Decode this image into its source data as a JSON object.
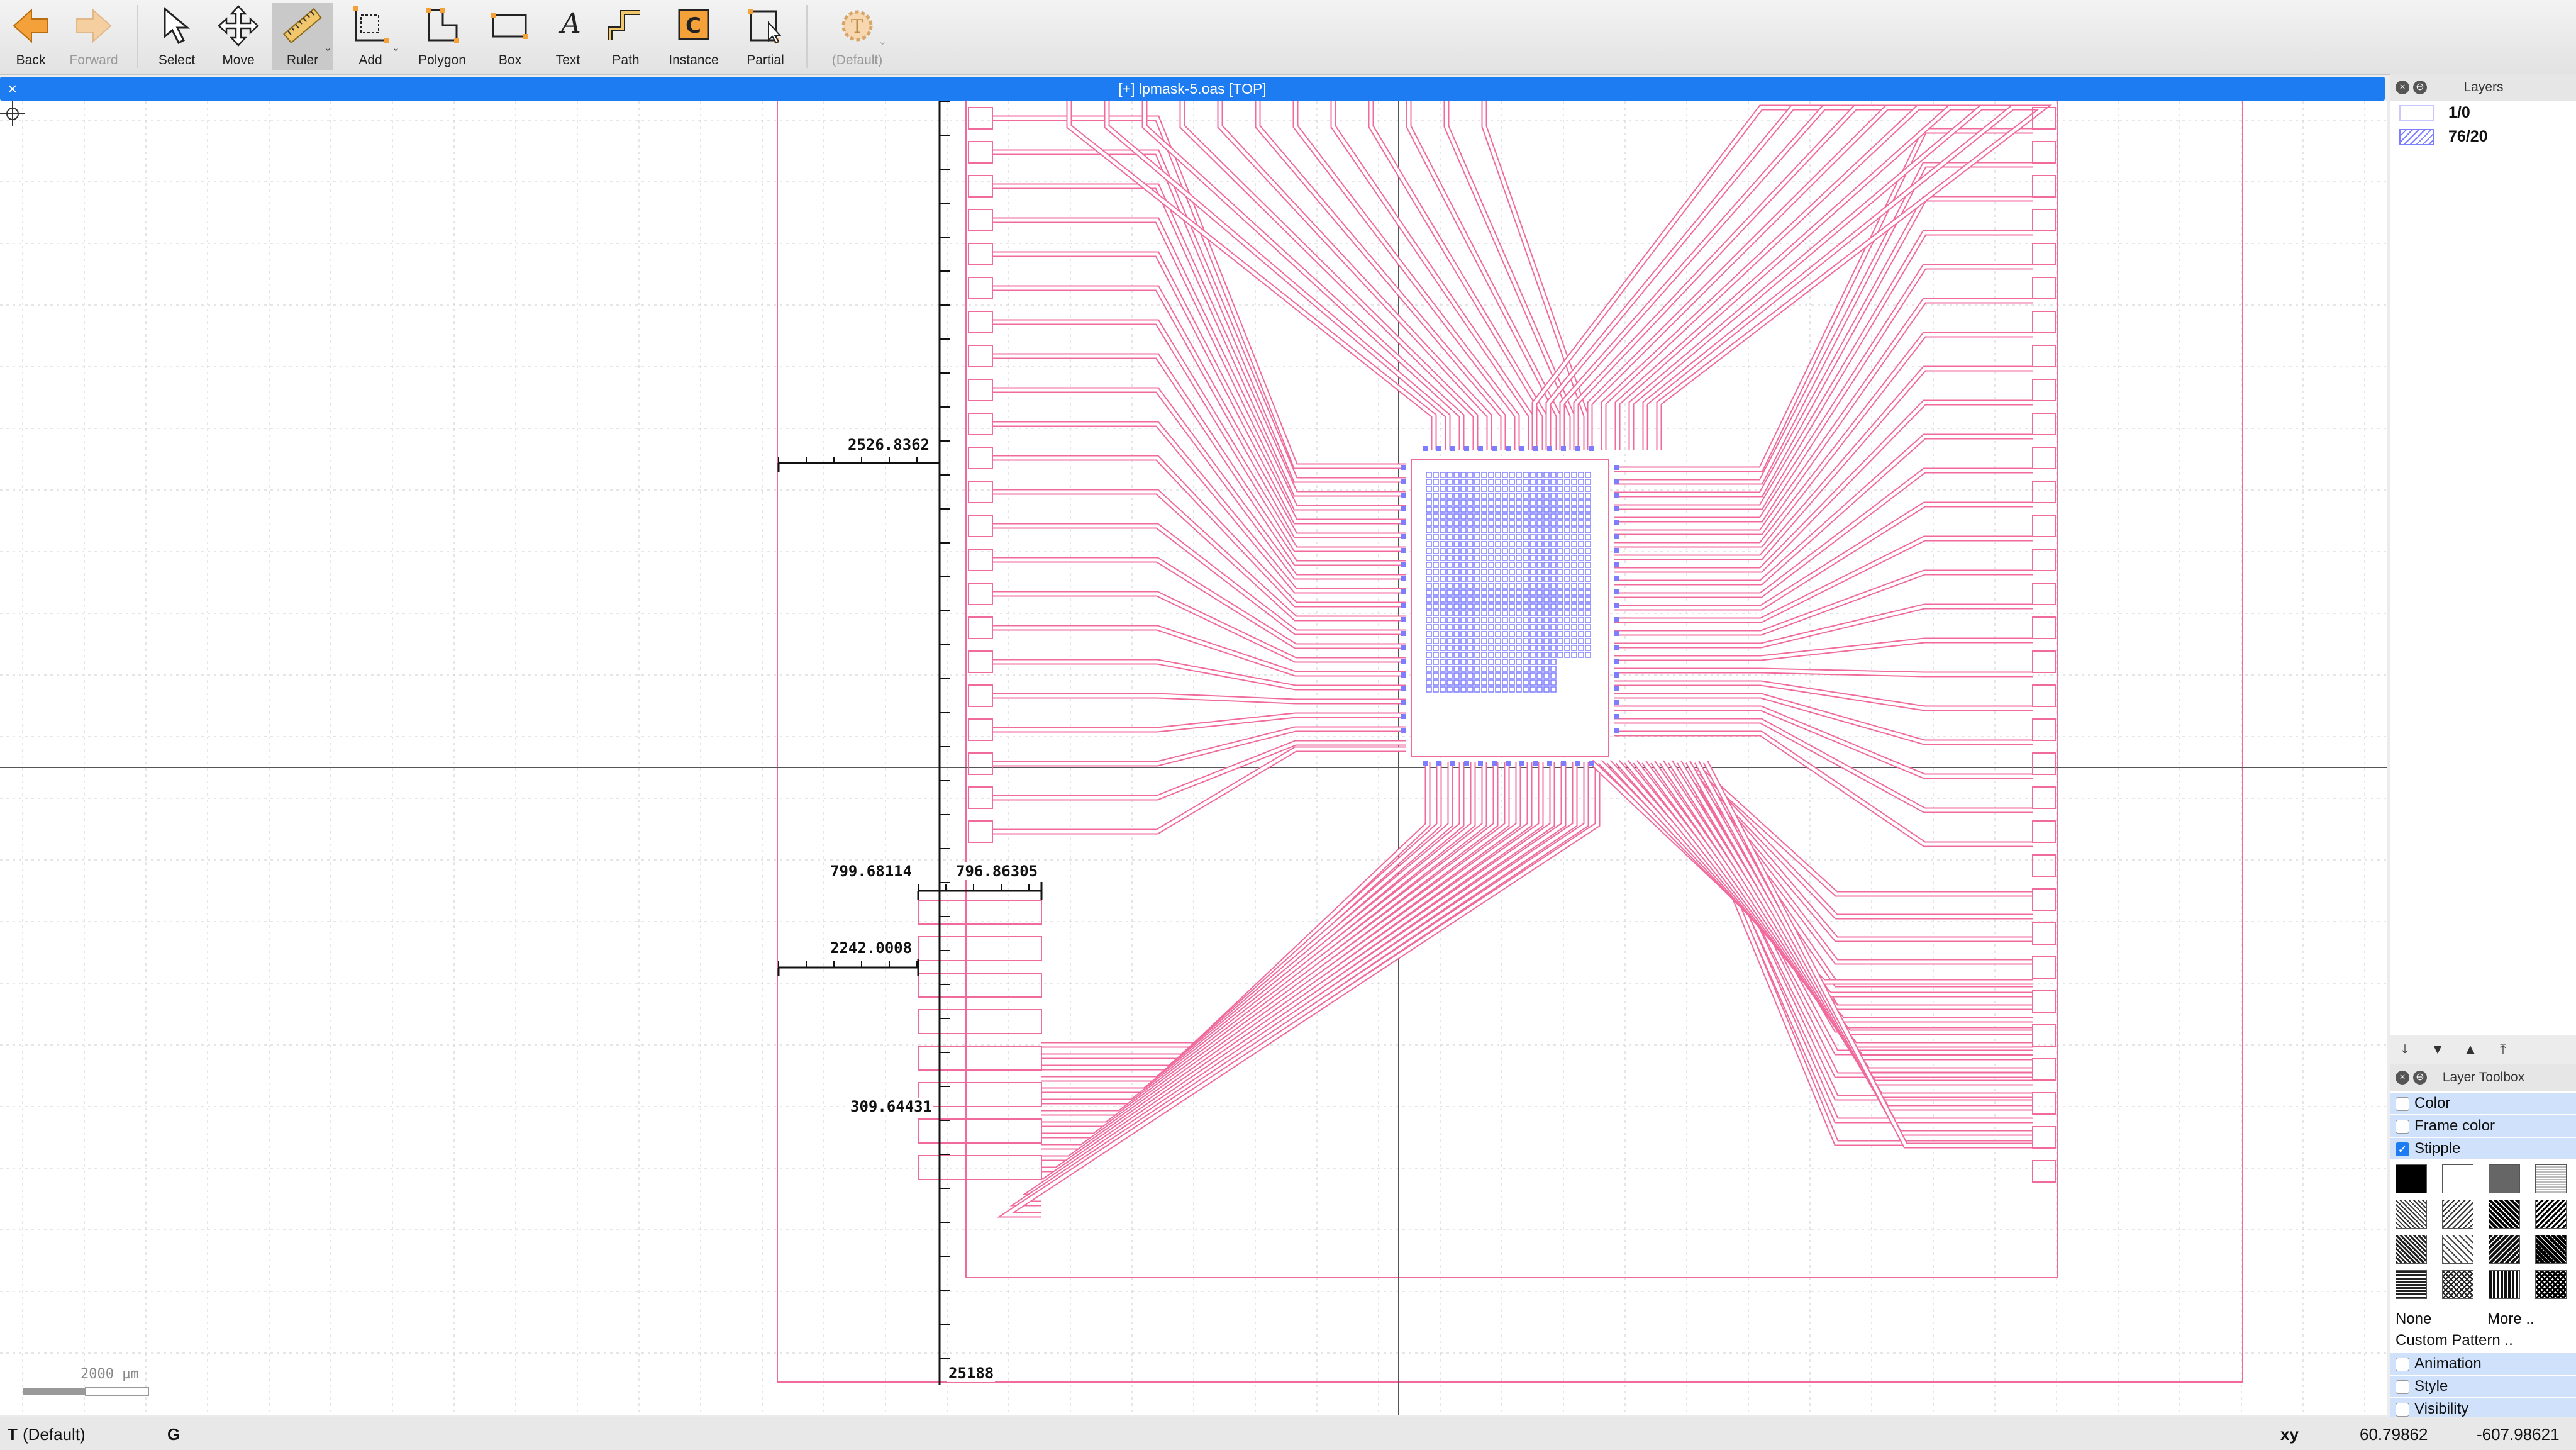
{
  "toolbar": {
    "back": "Back",
    "forward": "Forward",
    "select": "Select",
    "move": "Move",
    "ruler": "Ruler",
    "add": "Add",
    "polygon": "Polygon",
    "box": "Box",
    "text": "Text",
    "path": "Path",
    "instance": "Instance",
    "partial": "Partial",
    "default_tech": "(Default)",
    "text_tool_glyph": "A",
    "instance_glyph": "C",
    "tech_glyph": "T"
  },
  "view": {
    "title": "[+] lpmask-5.oas [TOP]",
    "close_glyph": "×"
  },
  "canvas": {
    "measurements": {
      "m1": "2526.8362",
      "m2": "799.68114",
      "m3": "796.86305",
      "m4": "2242.0008",
      "m5": "309.64431",
      "m6": "25188"
    },
    "scale_label": "2000 µm",
    "colors": {
      "metal": "#f06a9c",
      "die": "#7d7dff",
      "grid": "#cccccc",
      "axis": "#555555"
    }
  },
  "layers_panel": {
    "title": "Layers",
    "items": [
      {
        "name": "1/0",
        "swatch": "frame-pink"
      },
      {
        "name": "76/20",
        "swatch": "hatched-blue"
      }
    ],
    "nav_icons": [
      "move-down-bottom-icon",
      "move-down-icon",
      "move-up-icon",
      "move-up-top-icon"
    ]
  },
  "layer_toolbox": {
    "title": "Layer Toolbox",
    "color": "Color",
    "frame_color": "Frame color",
    "stipple": "Stipple",
    "stipple_checked": true,
    "none": "None",
    "more": "More ..",
    "custom_pattern": "Custom Pattern ..",
    "animation": "Animation",
    "style": "Style",
    "visibility": "Visibility"
  },
  "status": {
    "tech": "T",
    "tech_name": "(Default)",
    "grid_mode": "G",
    "coord_label": "xy",
    "x": "60.79862",
    "y": "-607.98621"
  }
}
